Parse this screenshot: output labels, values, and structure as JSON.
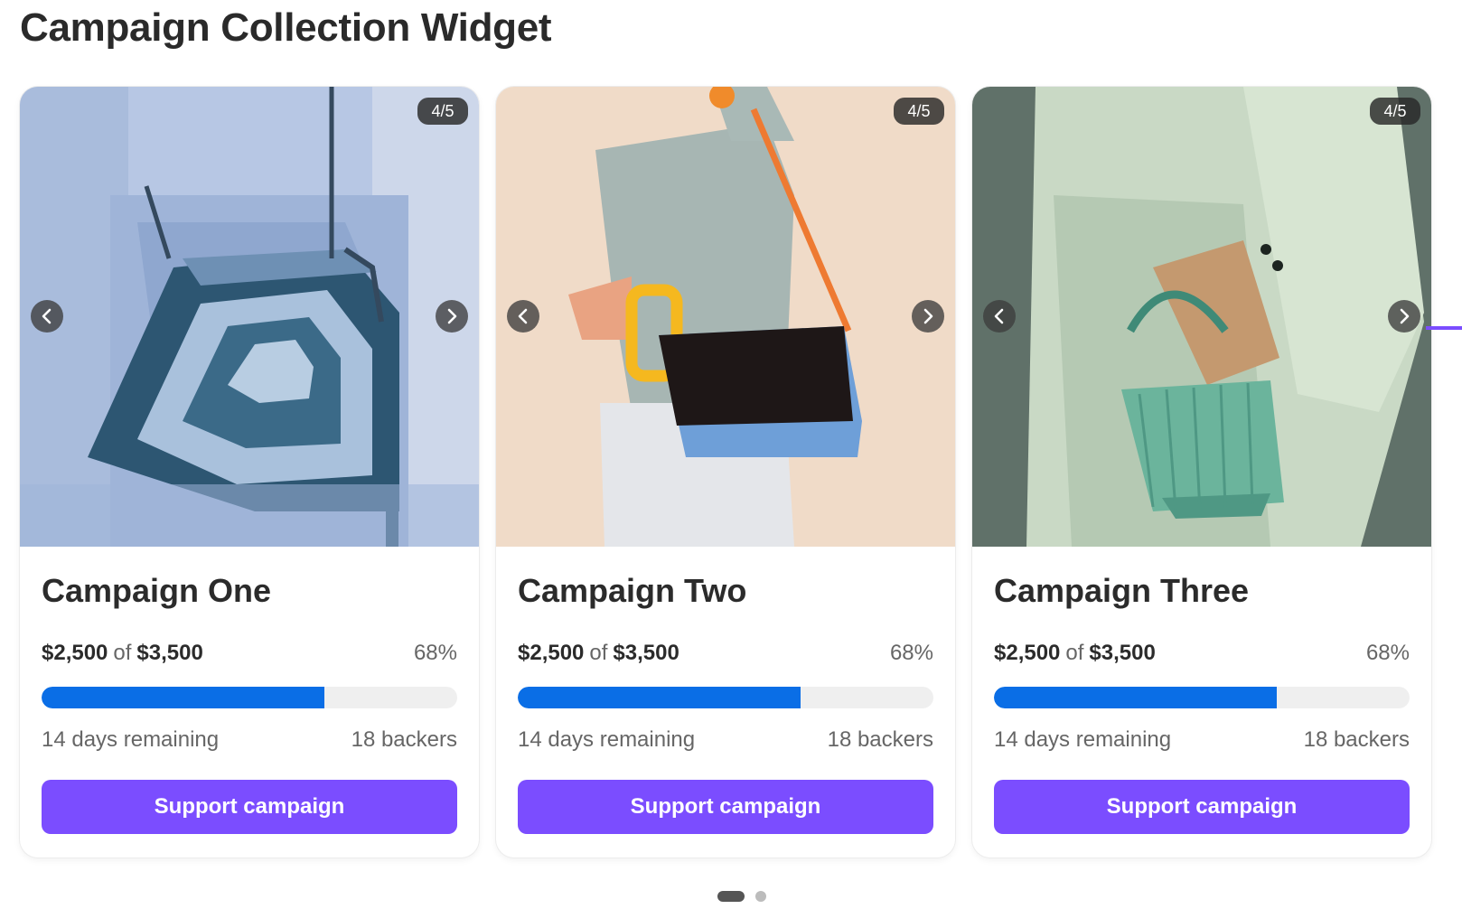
{
  "widget": {
    "title": "Campaign Collection Widget"
  },
  "cards": [
    {
      "title": "Campaign One",
      "slide_counter": "4/5",
      "raised": "$2,500",
      "of_label": "of",
      "goal": "$3,500",
      "percent_label": "68%",
      "progress": 0.68,
      "days_remaining": "14 days remaining",
      "backers": "18 backers",
      "button_label": "Support campaign",
      "image_description_colors": {
        "background": "#c9d3e6",
        "accent": "#2f4f66"
      }
    },
    {
      "title": "Campaign Two",
      "slide_counter": "4/5",
      "raised": "$2,500",
      "of_label": "of",
      "goal": "$3,500",
      "percent_label": "68%",
      "progress": 0.68,
      "days_remaining": "14 days remaining",
      "backers": "18 backers",
      "button_label": "Support campaign",
      "image_description_colors": {
        "background": "#efd6c1",
        "accent": "#1c1414"
      }
    },
    {
      "title": "Campaign Three",
      "slide_counter": "4/5",
      "raised": "$2,500",
      "of_label": "of",
      "goal": "$3,500",
      "percent_label": "68%",
      "progress": 0.68,
      "days_remaining": "14 days remaining",
      "backers": "18 backers",
      "button_label": "Support campaign",
      "image_description_colors": {
        "background": "#5f7069",
        "accent": "#6fb59f"
      }
    }
  ],
  "pager": {
    "active_page": 1,
    "total_pages": 2
  },
  "colors": {
    "progress_fill": "#0a6ee6",
    "progress_track": "#efefef",
    "button": "#7b4dff",
    "badge": "#2a2a2a"
  },
  "icons": {
    "prev": "chevron-left-icon",
    "next": "chevron-right-icon"
  }
}
